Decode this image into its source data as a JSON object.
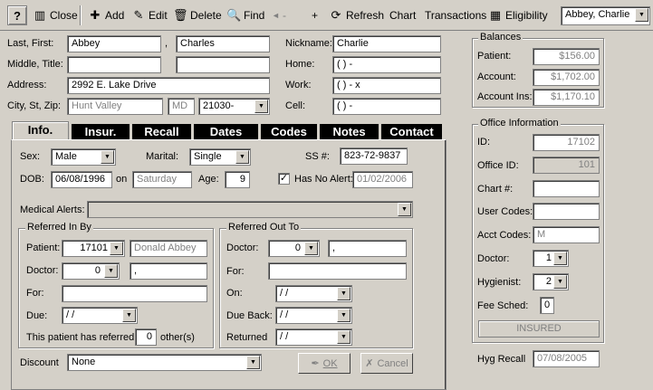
{
  "toolbar": {
    "help": "?",
    "close": "Close",
    "add": "Add",
    "edit": "Edit",
    "delete": "Delete",
    "find": "Find",
    "prev": "◄",
    "dash": "-",
    "next": "+",
    "refresh": "Refresh",
    "chart": "Chart",
    "transactions": "Transactions",
    "eligibility": "Eligibility",
    "patient_select": "Abbey, Charlie"
  },
  "patient": {
    "last_first_label": "Last, First:",
    "last": "Abbey",
    "comma": ",",
    "first": "Charles",
    "middle_title_label": "Middle, Title:",
    "middle": "",
    "title": "",
    "address_label": "Address:",
    "address": "2992 E. Lake Drive",
    "city_label": "City, St, Zip:",
    "city": "Hunt Valley",
    "state": "MD",
    "zip": "21030-",
    "nickname_label": "Nickname:",
    "nickname": "Charlie",
    "home_label": "Home:",
    "home": "(   )   -",
    "work_label": "Work:",
    "work": "(   )   -        x",
    "cell_label": "Cell:",
    "cell": "(   )   -"
  },
  "tabs": [
    "Info.",
    "Insur.",
    "Recall",
    "Dates",
    "Codes",
    "Notes",
    "Contact"
  ],
  "info": {
    "sex_label": "Sex:",
    "sex": "Male",
    "marital_label": "Marital:",
    "marital": "Single",
    "ss_label": "SS #:",
    "ss": "823-72-9837",
    "dob_label": "DOB:",
    "dob": "06/08/1996",
    "on_label": "on",
    "dob_day": "Saturday",
    "age_label": "Age:",
    "age": "9",
    "has_no_alert_label": "Has No Alert:",
    "has_no_alert_checked": "✓",
    "alert_date": "01/02/2006",
    "medical_alerts_label": "Medical Alerts:",
    "medical_alerts": "",
    "referred_in_title": "Referred In By",
    "ri_patient_label": "Patient:",
    "ri_patient_id": "17101",
    "ri_patient_name": "Donald Abbey",
    "ri_doctor_label": "Doctor:",
    "ri_doctor": "0",
    "ri_doctor_name": ",",
    "ri_for_label": "For:",
    "ri_for": "",
    "ri_due_label": "Due:",
    "ri_due": " /  /",
    "referred_text": "This patient has referred",
    "referred_count": "0",
    "others_text": "other(s)",
    "referred_out_title": "Referred Out To",
    "ro_doctor_label": "Doctor:",
    "ro_doctor": "0",
    "ro_doctor_name": ",",
    "ro_for_label": "For:",
    "ro_for": "",
    "ro_on_label": "On:",
    "ro_on": " /  /",
    "ro_due_back_label": "Due Back:",
    "ro_due_back": " /  /",
    "ro_returned_label": "Returned",
    "ro_returned": " /  /",
    "discount_label": "Discount",
    "discount": "None",
    "ok_label": "OK",
    "cancel_label": "Cancel"
  },
  "balances": {
    "title": "Balances",
    "patient_label": "Patient:",
    "patient": "$156.00",
    "account_label": "Account:",
    "account": "$1,702.00",
    "account_ins_label": "Account Ins:",
    "account_ins": "$1,170.10"
  },
  "office": {
    "title": "Office Information",
    "id_label": "ID:",
    "id": "17102",
    "office_id_label": "Office ID:",
    "office_id": "101",
    "chart_label": "Chart #:",
    "chart": "",
    "user_codes_label": "User Codes:",
    "user_codes": "",
    "acct_codes_label": "Acct Codes:",
    "acct_codes": "M",
    "doctor_label": "Doctor:",
    "doctor": "1",
    "hygienist_label": "Hygienist:",
    "hygienist": "2",
    "fee_sched_label": "Fee Sched:",
    "fee_sched": "0",
    "status": "INSURED",
    "hyg_recall_label": "Hyg Recall",
    "hyg_recall": "07/08/2005"
  }
}
